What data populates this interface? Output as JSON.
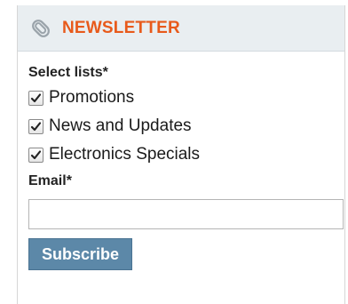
{
  "widget": {
    "title": "NEWSLETTER",
    "header_icon": "paperclip-icon",
    "title_color": "#e85a1b",
    "header_background": "#e9eef1"
  },
  "lists": {
    "label": "Select lists*",
    "items": [
      {
        "label": "Promotions",
        "checked": true
      },
      {
        "label": "News and Updates",
        "checked": true
      },
      {
        "label": "Electronics Specials",
        "checked": true
      }
    ]
  },
  "email": {
    "label": "Email*",
    "value": "",
    "placeholder": ""
  },
  "subscribe": {
    "label": "Subscribe",
    "color": "#5c88a8"
  }
}
